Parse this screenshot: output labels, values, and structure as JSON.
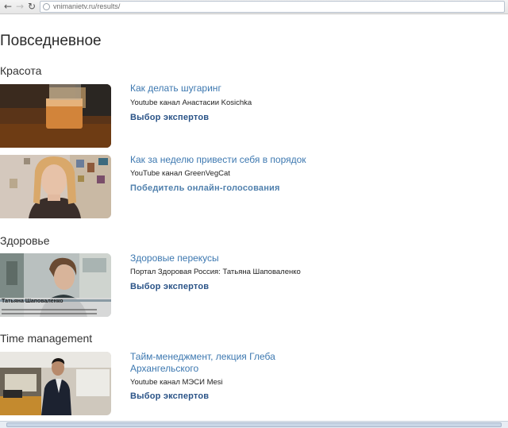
{
  "browser": {
    "url": "vnimanietv.ru/results/",
    "back_icon": "←",
    "forward_icon": "→",
    "reload_icon": "↻"
  },
  "page": {
    "title": "Повседневное"
  },
  "sections": [
    {
      "title": "Красота",
      "items": [
        {
          "title": "Как делать шугаринг",
          "source": "Youtube канал Анастасии Kosichka",
          "badge": "Выбор экспертов"
        },
        {
          "title": "Как за неделю привести себя в порядок",
          "source": "YouTube канал GreenVegCat",
          "badge": "Победитель онлайн-голосования"
        }
      ]
    },
    {
      "title": "Здоровье",
      "items": [
        {
          "title": "Здоровые перекусы",
          "source": "Портал Здоровая Россия: Татьяна Шаповаленко",
          "badge": "Выбор экспертов",
          "thumb_caption": "Татьяна Шаповаленко"
        }
      ]
    },
    {
      "title": "Time management",
      "items": [
        {
          "title": "Тайм-менеджмент, лекция Глеба Архангельского",
          "source": "Youtube канал МЭСИ Mesi",
          "badge": "Выбор экспертов"
        }
      ]
    }
  ]
}
